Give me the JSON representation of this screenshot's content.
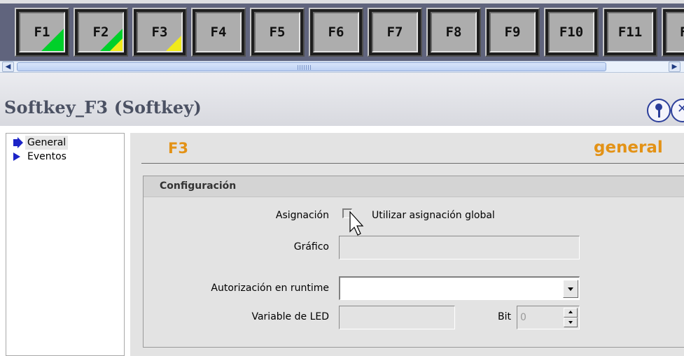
{
  "softkeys": [
    {
      "label": "F1",
      "indicator": "green"
    },
    {
      "label": "F2",
      "indicator": "green-yellow"
    },
    {
      "label": "F3",
      "indicator": "yellow"
    },
    {
      "label": "F4"
    },
    {
      "label": "F5"
    },
    {
      "label": "F6"
    },
    {
      "label": "F7"
    },
    {
      "label": "F8"
    },
    {
      "label": "F9"
    },
    {
      "label": "F10"
    },
    {
      "label": "F11"
    },
    {
      "label": "F"
    }
  ],
  "colors": {
    "indicator_green": "#00d02a",
    "indicator_yellow": "#f0ea1c",
    "accent_orange": "#e39216",
    "nav_marker": "#1c24c7"
  },
  "inspector": {
    "title": "Softkey_F3 (Softkey)",
    "pin_icon": "pin-icon",
    "close_icon": "close-icon"
  },
  "nav": {
    "items": [
      {
        "label": "General",
        "selected": true
      },
      {
        "label": "Eventos",
        "selected": false
      }
    ]
  },
  "content": {
    "header_name": "F3",
    "header_tab": "general",
    "group_title": "Configuración",
    "fields": {
      "asignacion_label": "Asignación",
      "asignacion_check_label": "Utilizar asignación global",
      "asignacion_checked": false,
      "grafico_label": "Gráfico",
      "grafico_value": "",
      "autorizacion_label": "Autorización en runtime",
      "autorizacion_value": "",
      "variable_led_label": "Variable de LED",
      "variable_led_value": "",
      "bit_label": "Bit",
      "bit_value": "0"
    }
  }
}
